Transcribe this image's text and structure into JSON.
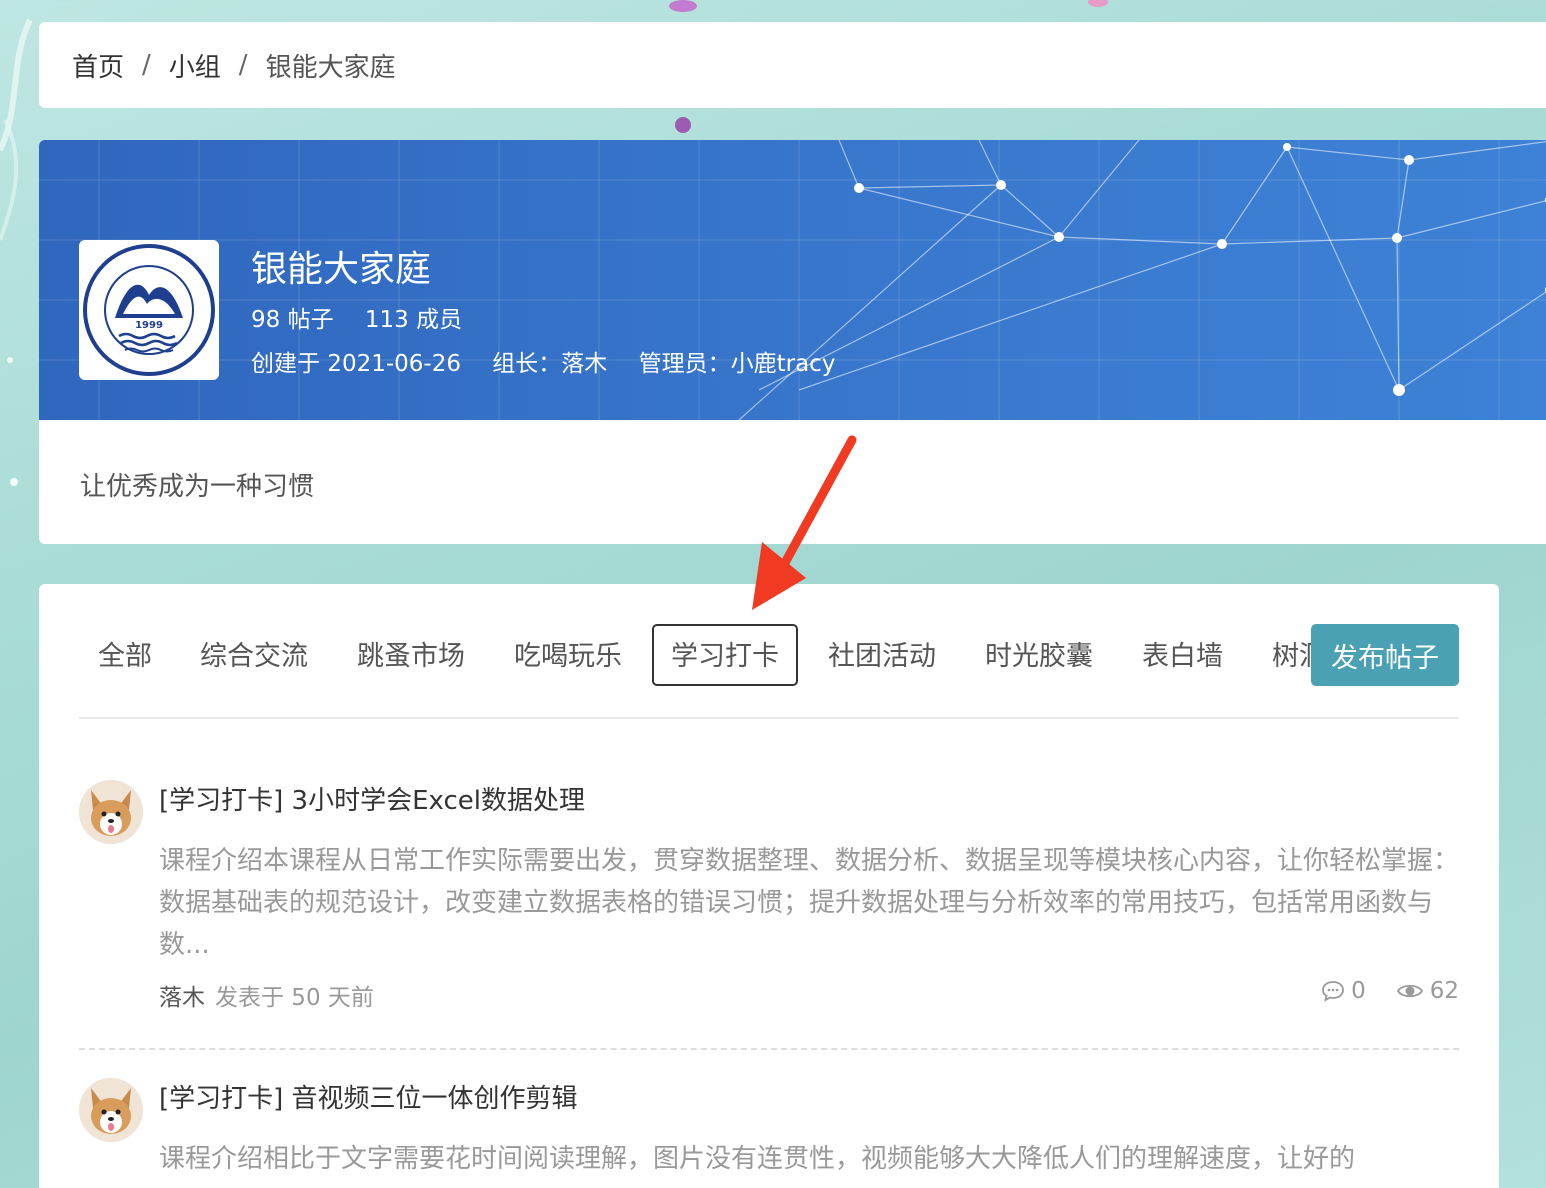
{
  "breadcrumb": {
    "home": "首页",
    "groups": "小组",
    "current": "银能大家庭",
    "separator": "/"
  },
  "group": {
    "name": "银能大家庭",
    "posts_count": "98 帖子",
    "members_count": "113 成员",
    "created": "创建于 2021-06-26",
    "leader": "组长：落木",
    "admin": "管理员：小鹿tracy",
    "motto": "让优秀成为一种习惯",
    "logo": {
      "year": "1999",
      "cn_name": "银川能源学院",
      "en_name": "YINCHUAN UNIVERSITY OF ENERGY"
    }
  },
  "tabs": [
    {
      "label": "全部",
      "active": false
    },
    {
      "label": "综合交流",
      "active": false
    },
    {
      "label": "跳蚤市场",
      "active": false
    },
    {
      "label": "吃喝玩乐",
      "active": false
    },
    {
      "label": "学习打卡",
      "active": true
    },
    {
      "label": "社团活动",
      "active": false
    },
    {
      "label": "时光胶囊",
      "active": false
    },
    {
      "label": "表白墙",
      "active": false
    },
    {
      "label": "树洞",
      "active": false
    }
  ],
  "publish_button": "发布帖子",
  "posts": [
    {
      "title": "[学习打卡] 3小时学会Excel数据处理",
      "excerpt": "课程介绍本课程从日常工作实际需要出发，贯穿数据整理、数据分析、数据呈现等模块核心内容，让你轻松掌握：数据基础表的规范设计，改变建立数据表格的错误习惯；提升数据处理与分析效率的常用技巧，包括常用函数与数...",
      "author": "落木",
      "time": "发表于 50 天前",
      "comments": "0",
      "views": "62"
    },
    {
      "title": "[学习打卡] 音视频三位一体创作剪辑",
      "excerpt": "课程介绍相比于文字需要花时间阅读理解，图片没有连贯性，视频能够大大降低人们的理解速度，让好的",
      "author": "",
      "time": "",
      "comments": "",
      "views": ""
    }
  ],
  "colors": {
    "accent": "#4aa1b4",
    "banner": "#3673c9",
    "arrow": "#f03a22",
    "background": "#a9dcd6"
  }
}
